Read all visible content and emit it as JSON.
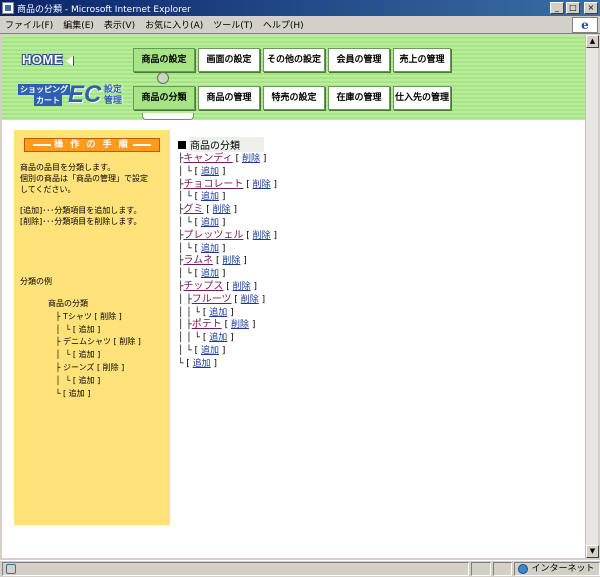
{
  "window": {
    "title": "商品の分類 - Microsoft Internet Explorer",
    "btn_min": "_",
    "btn_max": "□",
    "btn_close": "×"
  },
  "menu": {
    "items": [
      "ファイル(F)",
      "編集(E)",
      "表示(V)",
      "お気に入り(A)",
      "ツール(T)",
      "ヘルプ(H)"
    ]
  },
  "header": {
    "home_label": "HOME",
    "logo_line1": "ショッピング",
    "logo_line2": "カート",
    "logo_ec": "EC",
    "logo_side1": "設定",
    "logo_side2": "管理",
    "top_nav": [
      "商品の設定",
      "画面の設定",
      "その他の設定",
      "会員の管理",
      "売上の管理"
    ],
    "sub_nav": [
      "商品の分類",
      "商品の管理",
      "特売の設定",
      "在庫の管理",
      "仕入先の管理"
    ],
    "active_top": "商品の設定",
    "active_sub": "商品の分類"
  },
  "sidebar": {
    "header": "操 作 の 手 順",
    "desc_line1": "商品の品目を分類します。",
    "desc_line2": "個別の商品は「商品の管理」で設定",
    "desc_line3": "してください。",
    "help_add": "[追加]･･･分類項目を追加します。",
    "help_del": "[削除]･･･分類項目を削除します。",
    "example_title": "分類の例",
    "example_tree": "商品の分類\n   ├ Tシャツ [ 削除 ]\n   │  └ [ 追加 ]\n   ├ デニムシャツ [ 削除 ]\n   │  └ [ 追加 ]\n   ├ ジーンズ [ 削除 ]\n   │  └ [ 追加 ]\n   └ [ 追加 ]"
  },
  "tree": {
    "root": "商品の分類",
    "del_label": "削除",
    "add_label": "追加",
    "categories": [
      {
        "name": "キャンディ"
      },
      {
        "name": "チョコレート"
      },
      {
        "name": "グミ"
      },
      {
        "name": "プレッツェル"
      },
      {
        "name": "ラムネ"
      },
      {
        "name": "チップス",
        "children": [
          "フルーツ",
          "ポテト"
        ]
      }
    ]
  },
  "status": {
    "zone": "インターネット"
  }
}
